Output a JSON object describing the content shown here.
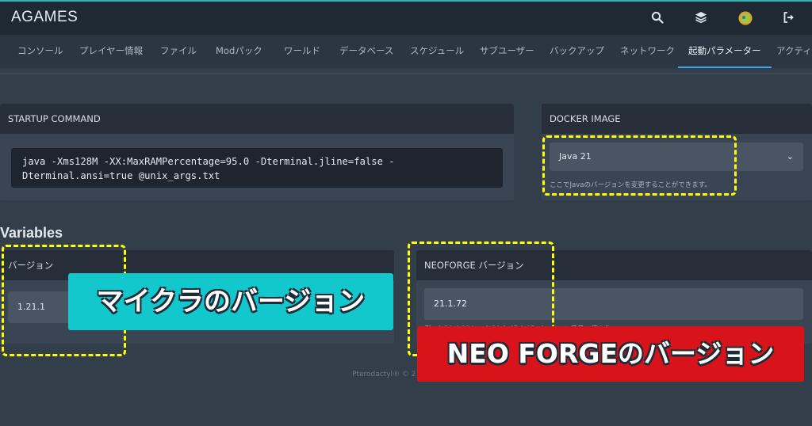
{
  "app": {
    "brand": "AGAMES"
  },
  "header_icons": [
    "search-icon",
    "layers-icon",
    "avatar",
    "logout-icon"
  ],
  "tabs": [
    {
      "label": "コンソール",
      "active": false
    },
    {
      "label": "プレイヤー情報",
      "active": false
    },
    {
      "label": "ファイル",
      "active": false
    },
    {
      "label": "Modパック",
      "active": false
    },
    {
      "label": "ワールド",
      "active": false
    },
    {
      "label": "データベース",
      "active": false
    },
    {
      "label": "スケジュール",
      "active": false
    },
    {
      "label": "サブユーザー",
      "active": false
    },
    {
      "label": "バックアップ",
      "active": false
    },
    {
      "label": "ネットワーク",
      "active": false
    },
    {
      "label": "起動パラメーター",
      "active": true
    },
    {
      "label": "アクティビ",
      "active": false
    }
  ],
  "startup": {
    "title": "STARTUP COMMAND",
    "command_line1": "java -Xms128M -XX:MaxRAMPercentage=95.0 -Dterminal.jline=false -",
    "command_line2": "Dterminal.ansi=true @unix_args.txt"
  },
  "docker": {
    "title": "DOCKER IMAGE",
    "selected": "Java 21",
    "hint": "ここでJavaのバージョンを変更することができます。"
  },
  "variables": {
    "title": "Variables",
    "version": {
      "label": "バージョン",
      "value": "1.21.1"
    },
    "neoforge": {
      "label": "NEOFORGE バージョン",
      "value": "21.1.72",
      "hint": "例：1.20.4.194 or 1.20.1-47.1.95 バージョン番号の値より"
    }
  },
  "footer": {
    "text": "Pterodactyl® © 2"
  },
  "annotations": {
    "minecraft_version": "マイクラのバージョン",
    "neoforge_version": "NEO FORGEのバージョン"
  },
  "colors": {
    "accent_cyan": "#12c8cc",
    "accent_red": "#d8141a",
    "highlight_yellow": "#ffff00",
    "tab_active_underline": "#3fa7e6"
  }
}
